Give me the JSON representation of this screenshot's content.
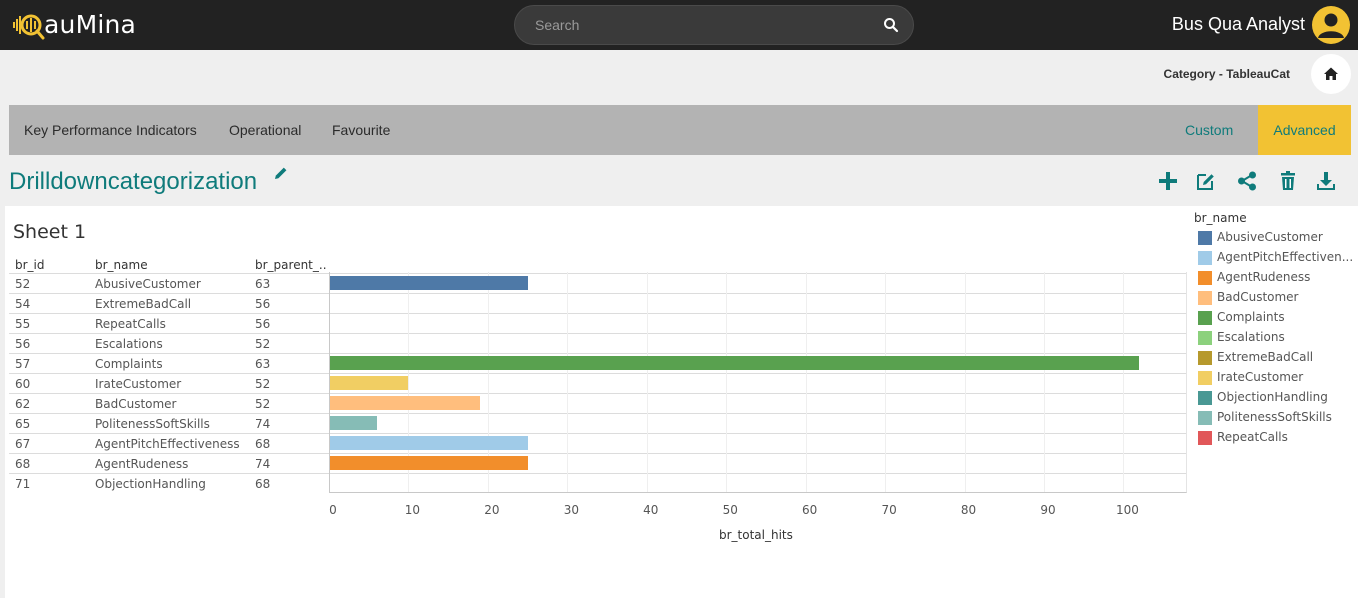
{
  "header": {
    "logo_text": "auMina",
    "search_placeholder": "Search",
    "user_name": "Bus Qua Analyst"
  },
  "subheader": {
    "category_label": "Category - TableauCat"
  },
  "nav": {
    "items": [
      "Key Performance Indicators",
      "Operational",
      "Favourite"
    ],
    "custom": "Custom",
    "advanced": "Advanced"
  },
  "page": {
    "title": "Drilldowncategorization"
  },
  "colors": {
    "accent_teal": "#0f7b7b",
    "accent_yellow": "#f2c233"
  },
  "toolbar_icons": [
    "plus-icon",
    "edit-icon",
    "share-icon",
    "trash-icon",
    "download-icon"
  ],
  "sheet": {
    "title": "Sheet 1",
    "columns": [
      "br_id",
      "br_name",
      "br_parent_.."
    ],
    "legend_title": "br_name"
  },
  "chart_data": {
    "type": "bar",
    "orientation": "horizontal",
    "rows": [
      {
        "br_id": "52",
        "br_name": "AbusiveCustomer",
        "br_parent": "63",
        "value": 25,
        "color": "#4e79a7"
      },
      {
        "br_id": "54",
        "br_name": "ExtremeBadCall",
        "br_parent": "56",
        "value": 0,
        "color": "#b6992d"
      },
      {
        "br_id": "55",
        "br_name": "RepeatCalls",
        "br_parent": "56",
        "value": 0,
        "color": "#e15759"
      },
      {
        "br_id": "56",
        "br_name": "Escalations",
        "br_parent": "52",
        "value": 0,
        "color": "#8cd17d"
      },
      {
        "br_id": "57",
        "br_name": "Complaints",
        "br_parent": "63",
        "value": 102,
        "color": "#59a14f"
      },
      {
        "br_id": "60",
        "br_name": "IrateCustomer",
        "br_parent": "52",
        "value": 10,
        "color": "#f1ce63"
      },
      {
        "br_id": "62",
        "br_name": "BadCustomer",
        "br_parent": "52",
        "value": 19,
        "color": "#ffbe7d"
      },
      {
        "br_id": "65",
        "br_name": "PolitenessSoftSkills",
        "br_parent": "74",
        "value": 6,
        "color": "#86bcb6"
      },
      {
        "br_id": "67",
        "br_name": "AgentPitchEffectiveness",
        "br_parent": "68",
        "value": 25,
        "color": "#a0cbe8"
      },
      {
        "br_id": "68",
        "br_name": "AgentRudeness",
        "br_parent": "74",
        "value": 25,
        "color": "#f28e2b"
      },
      {
        "br_id": "71",
        "br_name": "ObjectionHandling",
        "br_parent": "68",
        "value": 0,
        "color": "#499894"
      }
    ],
    "x_ticks": [
      "0",
      "10",
      "20",
      "30",
      "40",
      "50",
      "60",
      "70",
      "80",
      "90",
      "100"
    ],
    "xlim": [
      0,
      108
    ],
    "xlabel": "br_total_hits",
    "legend": [
      {
        "label": "AbusiveCustomer",
        "color": "#4e79a7"
      },
      {
        "label": "AgentPitchEffectiven...",
        "color": "#a0cbe8"
      },
      {
        "label": "AgentRudeness",
        "color": "#f28e2b"
      },
      {
        "label": "BadCustomer",
        "color": "#ffbe7d"
      },
      {
        "label": "Complaints",
        "color": "#59a14f"
      },
      {
        "label": "Escalations",
        "color": "#8cd17d"
      },
      {
        "label": "ExtremeBadCall",
        "color": "#b6992d"
      },
      {
        "label": "IrateCustomer",
        "color": "#f1ce63"
      },
      {
        "label": "ObjectionHandling",
        "color": "#499894"
      },
      {
        "label": "PolitenessSoftSkills",
        "color": "#86bcb6"
      },
      {
        "label": "RepeatCalls",
        "color": "#e15759"
      }
    ],
    "legend_placement": "right",
    "grid": true
  }
}
